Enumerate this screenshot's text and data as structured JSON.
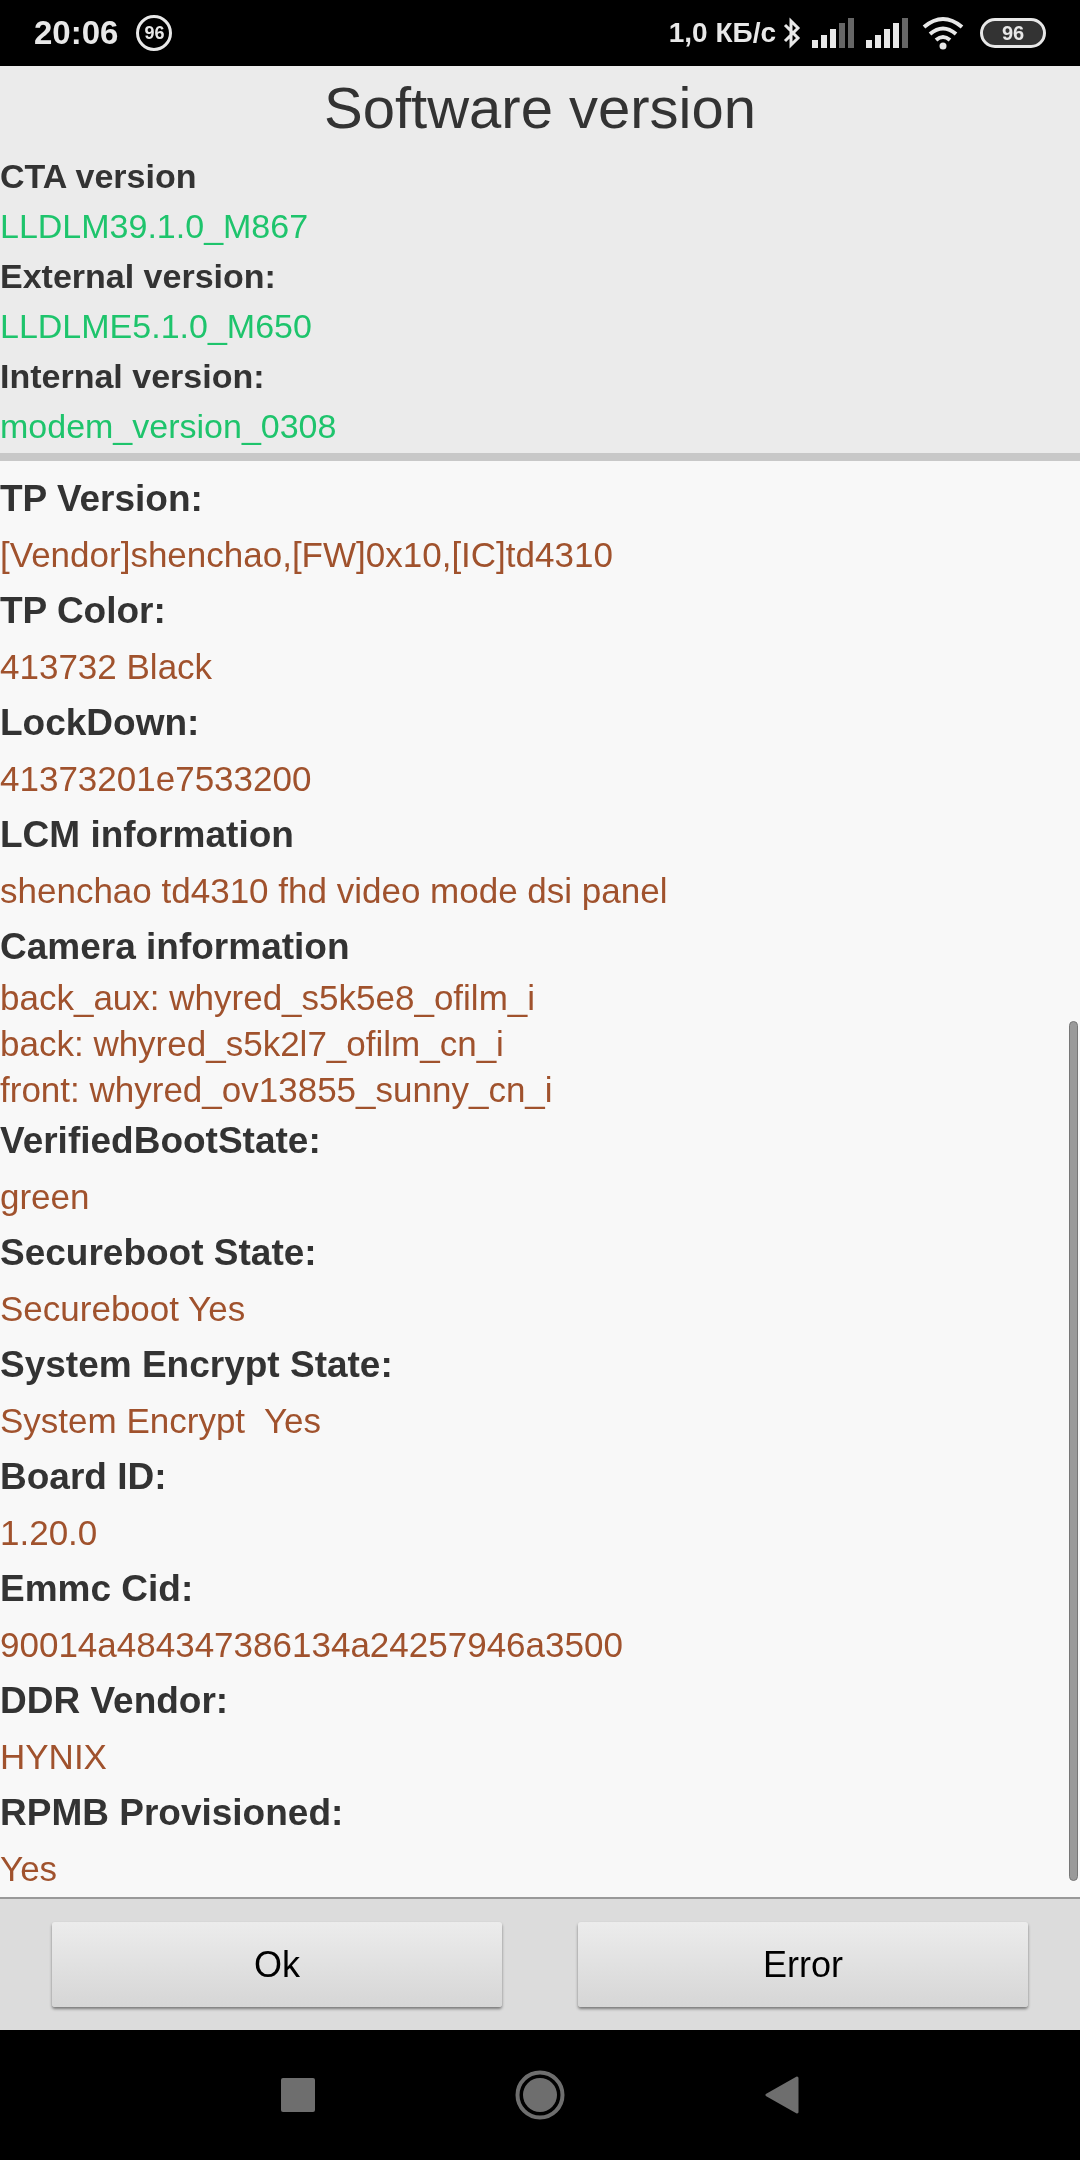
{
  "status_bar": {
    "time": "20:06",
    "notification_badge": "96",
    "network_speed": "1,0 КБ/с",
    "battery": "96"
  },
  "title": "Software version",
  "modem_section": [
    {
      "label": "CTA version",
      "values": [
        "LLDLM39.1.0_M867"
      ]
    },
    {
      "label": "External version:",
      "values": [
        "LLDLME5.1.0_M650"
      ]
    },
    {
      "label": "Internal version:",
      "values": [
        "modem_version_0308"
      ]
    }
  ],
  "info_section": [
    {
      "label": "TP Version:",
      "values": [
        "[Vendor]shenchao,[FW]0x10,[IC]td4310"
      ]
    },
    {
      "label": "TP Color:",
      "values": [
        "413732 Black"
      ]
    },
    {
      "label": "LockDown:",
      "values": [
        "41373201e7533200"
      ]
    },
    {
      "label": "LCM information",
      "values": [
        "shenchao td4310 fhd video mode dsi panel"
      ]
    },
    {
      "label": "Camera information",
      "values": [
        "back_aux: whyred_s5k5e8_ofilm_i",
        "back: whyred_s5k2l7_ofilm_cn_i",
        "front: whyred_ov13855_sunny_cn_i"
      ]
    },
    {
      "label": "VerifiedBootState:",
      "values": [
        "green"
      ]
    },
    {
      "label": "Secureboot State:",
      "values": [
        "Secureboot Yes"
      ]
    },
    {
      "label": "System Encrypt State:",
      "values": [
        "System Encrypt  Yes"
      ]
    },
    {
      "label": "Board ID:",
      "values": [
        "1.20.0"
      ]
    },
    {
      "label": "Emmc Cid:",
      "values": [
        "90014a484347386134a24257946a3500"
      ]
    },
    {
      "label": "DDR Vendor:",
      "values": [
        "HYNIX"
      ]
    },
    {
      "label": "RPMB Provisioned:",
      "values": [
        "Yes"
      ]
    }
  ],
  "buttons": [
    "Ok",
    "Error"
  ]
}
